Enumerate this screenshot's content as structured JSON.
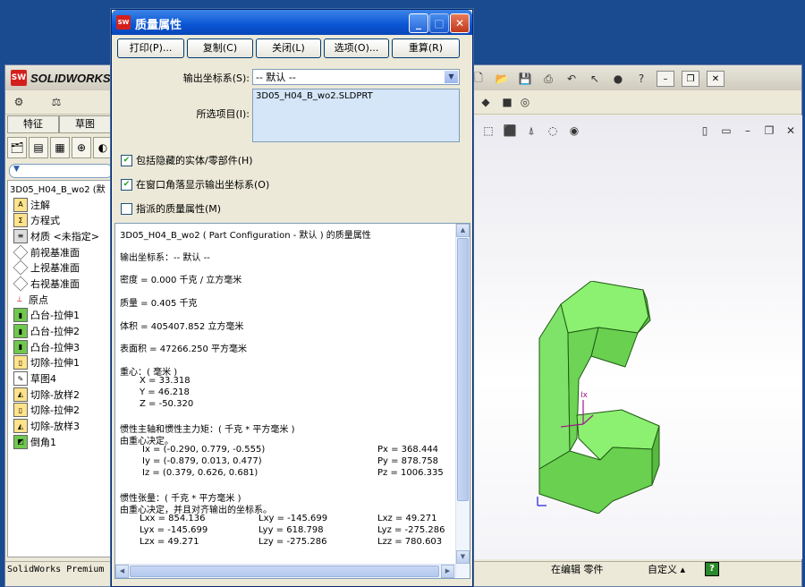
{
  "main_window": {
    "brand_mark": "SW",
    "brand_word": "SOLIDWORKS",
    "tabs": [
      "特征",
      "草图"
    ],
    "tree_root": "3D05_H04_B_wo2  (默",
    "tree_items": [
      {
        "label": "注解",
        "icon": "annotations-icon"
      },
      {
        "label": "方程式",
        "icon": "equations-icon"
      },
      {
        "label": "材质 <未指定>",
        "icon": "material-icon"
      },
      {
        "label": "前视基准面",
        "icon": "plane-icon"
      },
      {
        "label": "上视基准面",
        "icon": "plane-icon"
      },
      {
        "label": "右视基准面",
        "icon": "plane-icon"
      },
      {
        "label": "原点",
        "icon": "origin-icon"
      },
      {
        "label": "凸台-拉伸1",
        "icon": "extrude-icon"
      },
      {
        "label": "凸台-拉伸2",
        "icon": "extrude-icon"
      },
      {
        "label": "凸台-拉伸3",
        "icon": "extrude-icon"
      },
      {
        "label": "切除-拉伸1",
        "icon": "cut-extrude-icon"
      },
      {
        "label": "草图4",
        "icon": "sketch-icon"
      },
      {
        "label": "切除-放样2",
        "icon": "cut-loft-icon"
      },
      {
        "label": "切除-拉伸2",
        "icon": "cut-extrude-icon"
      },
      {
        "label": "切除-放样3",
        "icon": "cut-loft-icon"
      },
      {
        "label": "倒角1",
        "icon": "chamfer-icon"
      }
    ],
    "status": {
      "product": "SolidWorks Premium",
      "editing": "在编辑 零件",
      "custom": "自定义 ▴",
      "help": "?"
    }
  },
  "dialog": {
    "title": "质量属性",
    "buttons": {
      "print": "打印(P)...",
      "copy": "复制(C)",
      "close": "关闭(L)",
      "options": "选项(O)...",
      "recalc": "重算(R)"
    },
    "coord_label": "输出坐标系(S):",
    "coord_value": "-- 默认 --",
    "selected_label": "所选项目(I):",
    "selected_item": "3D05_H04_B_wo2.SLDPRT",
    "checks": [
      {
        "label": "包括隐藏的实体/零部件(H)",
        "checked": true
      },
      {
        "label": "在窗口角落显示输出坐标系(O)",
        "checked": true
      },
      {
        "label": "指派的质量属性(M)",
        "checked": false
      }
    ],
    "report": {
      "header": "3D05_H04_B_wo2 ( Part Configuration - 默认 ) 的质量属性",
      "coord": "输出坐标系：-- 默认 --",
      "density": "密度 = 0.000 千克 /  立方毫米",
      "mass": "质量 = 0.405 千克",
      "volume": "体积 = 405407.852  立方毫米",
      "area": "表面积 = 47266.250  平方毫米",
      "cog_title": "重心：( 毫米 )",
      "cog_x": "X = 33.318",
      "cog_y": "Y = 46.218",
      "cog_z": "Z = -50.320",
      "axes_title": "惯性主轴和惯性主力矩：( 千克 *  平方毫米 )",
      "axes_note": "由重心决定。",
      "ix": "Ix = (-0.290, 0.779, -0.555)",
      "iy": "Iy = (-0.879, 0.013, 0.477)",
      "iz": "Iz = (0.379, 0.626, 0.681)",
      "px": "Px = 368.444",
      "py": "Py = 878.758",
      "pz": "Pz = 1006.335",
      "tensor_title": "惯性张量：( 千克 *  平方毫米 )",
      "tensor_note": "由重心决定，并且对齐输出的坐标系。",
      "lxx": "Lxx = 854.136",
      "lxy": "Lxy = -145.699",
      "lxz": "Lxz = 49.271",
      "lyx": "Lyx = -145.699",
      "lyy": "Lyy = 618.798",
      "lyz": "Lyz = -275.286",
      "lzx": "Lzx = 49.271",
      "lzy": "Lzy = -275.286",
      "lzz": "Lzz = 780.603"
    }
  },
  "viewport": {
    "axis_label": "Ix",
    "model_color": "#7fe36a"
  }
}
